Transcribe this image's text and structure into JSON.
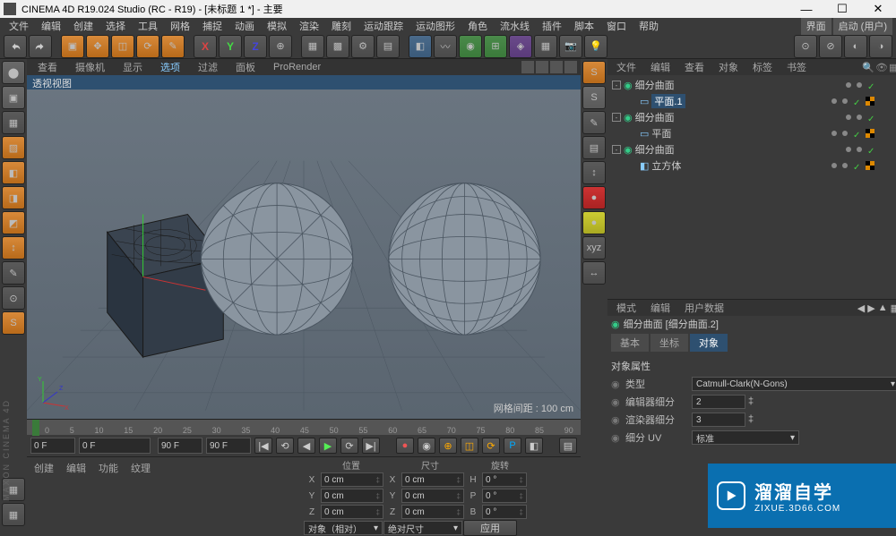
{
  "window": {
    "title": "CINEMA 4D R19.024 Studio (RC - R19) - [未标题 1 *] - 主要",
    "min": "—",
    "max": "☐",
    "close": "✕"
  },
  "menu": {
    "items": [
      "文件",
      "编辑",
      "创建",
      "选择",
      "工具",
      "网格",
      "捕捉",
      "动画",
      "模拟",
      "渲染",
      "雕刻",
      "运动跟踪",
      "运动图形",
      "角色",
      "流水线",
      "插件",
      "脚本",
      "窗口",
      "帮助"
    ],
    "right": [
      "界面",
      "启动 (用户)"
    ]
  },
  "viewport": {
    "tabs": [
      "查看",
      "摄像机",
      "显示",
      "选项",
      "过滤",
      "面板",
      "ProRender"
    ],
    "header": "透视视图",
    "grid_label": "网格间距 : 100 cm",
    "axes": {
      "x": "X",
      "y": "Y",
      "z": "Z"
    }
  },
  "timeline": {
    "ticks": [
      "0",
      "5",
      "10",
      "15",
      "20",
      "25",
      "30",
      "35",
      "40",
      "45",
      "50",
      "55",
      "60",
      "65",
      "70",
      "75",
      "80",
      "85",
      "90"
    ],
    "frame_start": "0 F",
    "frame_cur": "0 F",
    "frame_end1": "90 F",
    "frame_end2": "90 F"
  },
  "bottom": {
    "tabs": [
      "创建",
      "编辑",
      "功能",
      "纹理"
    ]
  },
  "coord": {
    "hdr": {
      "pos": "位置",
      "size": "尺寸",
      "rot": "旋转"
    },
    "x": {
      "l": "X",
      "p": "0 cm",
      "s": "0 cm",
      "rl": "H",
      "r": "0 °"
    },
    "y": {
      "l": "Y",
      "p": "0 cm",
      "s": "0 cm",
      "rl": "P",
      "r": "0 °"
    },
    "z": {
      "l": "Z",
      "p": "0 cm",
      "s": "0 cm",
      "rl": "B",
      "r": "0 °"
    },
    "mode1": "对象（相对）",
    "mode2": "绝对尺寸",
    "apply": "应用"
  },
  "objmgr": {
    "tabs": [
      "文件",
      "编辑",
      "查看",
      "对象",
      "标签",
      "书签"
    ],
    "tree": [
      {
        "depth": 0,
        "expand": "-",
        "icon": "sds",
        "name": "细分曲面",
        "sel": false,
        "dots": true
      },
      {
        "depth": 1,
        "expand": "",
        "icon": "plane",
        "name": "平面.1",
        "sel": true,
        "dots": true,
        "chk": true
      },
      {
        "depth": 0,
        "expand": "-",
        "icon": "sds",
        "name": "细分曲面",
        "sel": false,
        "dots": true
      },
      {
        "depth": 1,
        "expand": "",
        "icon": "plane",
        "name": "平面",
        "sel": false,
        "dots": true,
        "chk": true
      },
      {
        "depth": 0,
        "expand": "-",
        "icon": "sds",
        "name": "细分曲面",
        "sel": false,
        "dots": true
      },
      {
        "depth": 1,
        "expand": "",
        "icon": "cube",
        "name": "立方体",
        "sel": false,
        "dots": true,
        "chk": true
      }
    ]
  },
  "attr": {
    "tabs": [
      "模式",
      "编辑",
      "用户数据"
    ],
    "header": "细分曲面 [细分曲面.2]",
    "subtabs": [
      "基本",
      "坐标",
      "对象"
    ],
    "section": "对象属性",
    "rows": {
      "type_label": "类型",
      "type_value": "Catmull-Clark(N-Gons)",
      "editor_label": "编辑器细分",
      "editor_value": "2",
      "render_label": "渲染器细分",
      "render_value": "3",
      "uv_label": "细分 UV",
      "uv_value": "标准"
    }
  },
  "watermark": {
    "big": "溜溜自学",
    "small": "ZIXUE.3D66.COM"
  },
  "maxon": "MAXON CINEMA 4D"
}
